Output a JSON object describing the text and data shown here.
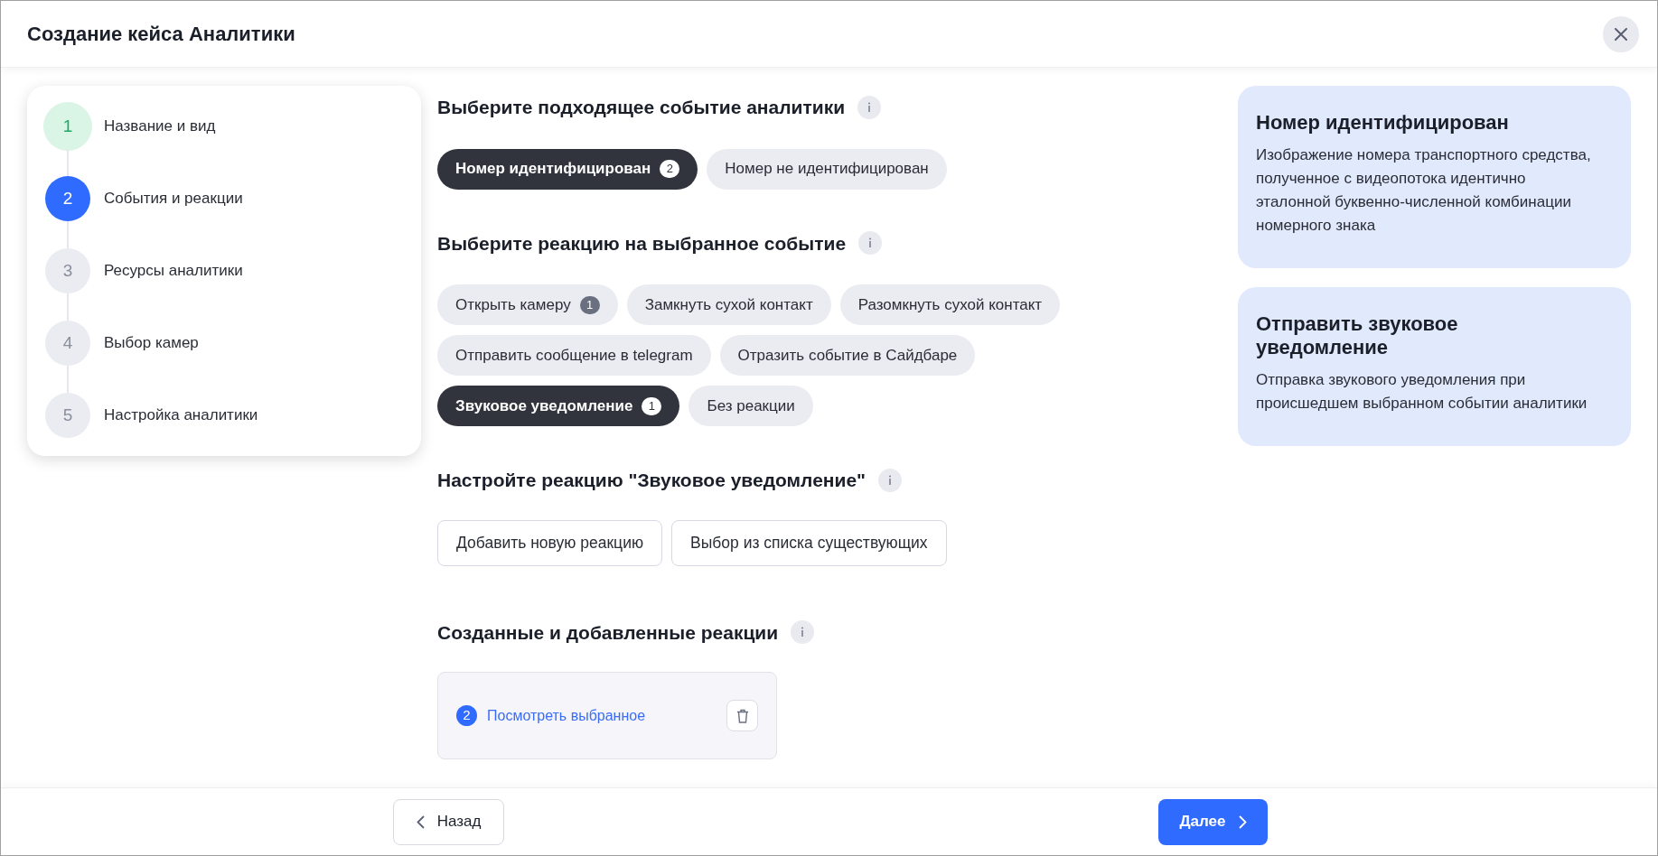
{
  "window": {
    "title": "Создание кейса Аналитики"
  },
  "steps": [
    {
      "number": "1",
      "label": "Название и вид",
      "completed": true,
      "selected": false
    },
    {
      "number": "2",
      "label": "События и реакции",
      "completed": false,
      "selected": true
    },
    {
      "number": "3",
      "label": "Ресурсы аналитики",
      "completed": false,
      "selected": false
    },
    {
      "number": "4",
      "label": "Выбор камер",
      "completed": false,
      "selected": false
    },
    {
      "number": "5",
      "label": "Настройка аналитики",
      "completed": false,
      "selected": false
    }
  ],
  "event_section": {
    "title": "Выберите подходящее событие аналитики",
    "options": [
      {
        "label": "Номер идентифицирован",
        "selected": true,
        "count": "2"
      },
      {
        "label": "Номер не идентифицирован",
        "selected": false
      }
    ]
  },
  "reaction_section": {
    "title": "Выберите реакцию на выбранное событие",
    "options": [
      {
        "label": "Открыть камеру",
        "selected": false,
        "count": "1"
      },
      {
        "label": "Замкнуть сухой контакт",
        "selected": false
      },
      {
        "label": "Разомкнуть сухой контакт",
        "selected": false
      },
      {
        "label": "Отправить сообщение в telegram",
        "selected": false
      },
      {
        "label": "Отразить событие в Сайдбаре",
        "selected": false
      },
      {
        "label": "Звуковое уведомление",
        "selected": true,
        "count": "1"
      },
      {
        "label": "Без реакции",
        "selected": false
      }
    ]
  },
  "configure_section": {
    "title": "Настройте реакцию \"Звуковое уведомление\"",
    "buttons": [
      "Добавить новую реакцию",
      "Выбор из списка существующих"
    ]
  },
  "created_section": {
    "title": "Созданные и добавленные реакции",
    "items": [
      {
        "count": "2",
        "link": "Посмотреть выбранное"
      }
    ]
  },
  "info_cards": [
    {
      "title": "Номер идентифицирован",
      "text": "Изображение номера транспортного средства, полученное с видеопотока идентично эталонной буквенно-численной комбинации номерного знака"
    },
    {
      "title": "Отправить звуковое уведомление",
      "text": "Отправка звукового уведомления при происшедшем выбранном событии аналитики"
    }
  ],
  "footer": {
    "back": "Назад",
    "next": "Далее"
  }
}
